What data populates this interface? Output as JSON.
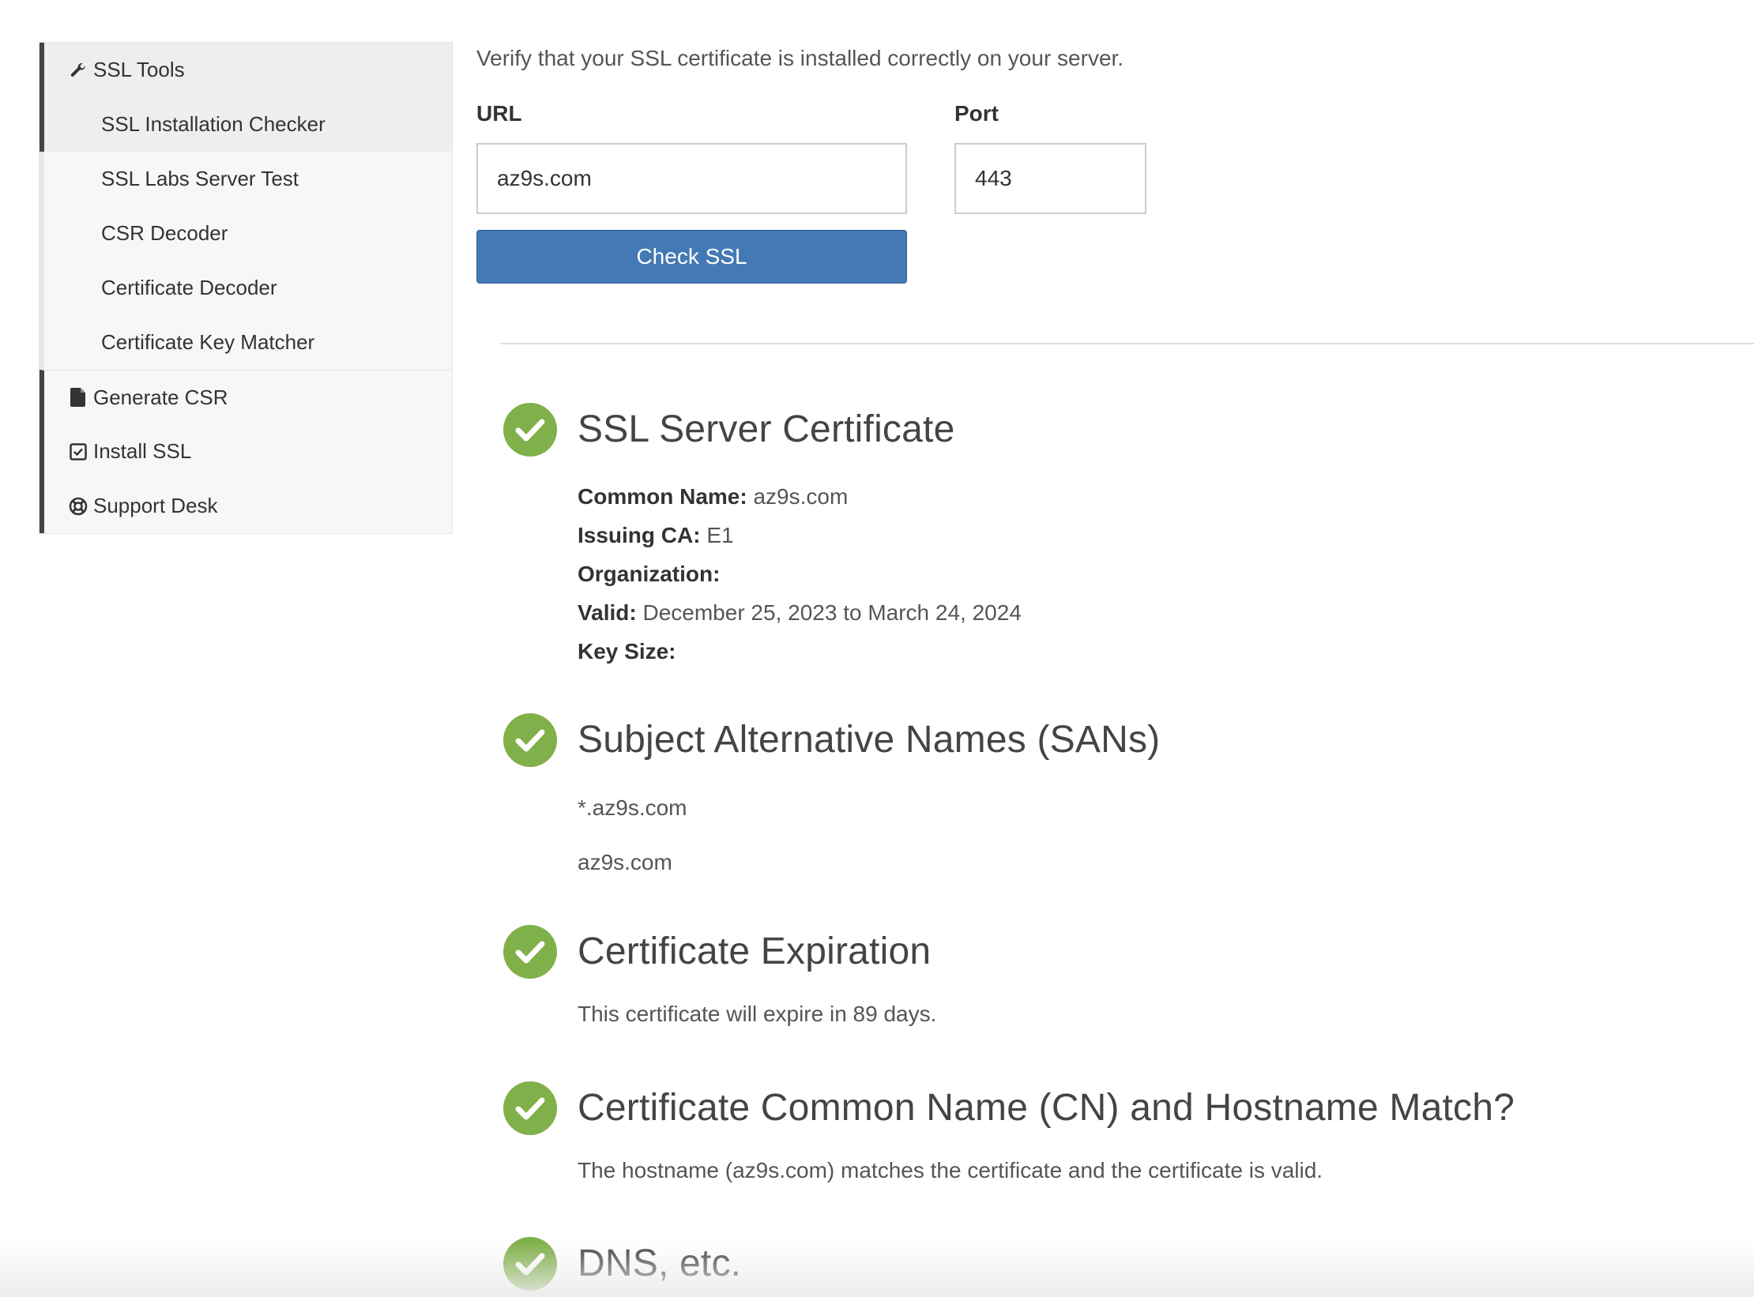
{
  "sidebar": {
    "items": [
      {
        "label": "SSL Tools",
        "icon": "wrench-icon"
      },
      {
        "label": "SSL Installation Checker"
      },
      {
        "label": "SSL Labs Server Test"
      },
      {
        "label": "CSR Decoder"
      },
      {
        "label": "Certificate Decoder"
      },
      {
        "label": "Certificate Key Matcher"
      },
      {
        "label": "Generate CSR",
        "icon": "file-icon"
      },
      {
        "label": "Install SSL",
        "icon": "checkbox-icon"
      },
      {
        "label": "Support Desk",
        "icon": "lifebuoy-icon"
      }
    ]
  },
  "form": {
    "intro": "Verify that your SSL certificate is installed correctly on your server.",
    "url_label": "URL",
    "url_value": "az9s.com",
    "port_label": "Port",
    "port_value": "443",
    "submit_label": "Check SSL"
  },
  "results": {
    "server_cert": {
      "title": "SSL Server Certificate",
      "common_name_label": "Common Name:",
      "common_name": "az9s.com",
      "issuing_ca_label": "Issuing CA:",
      "issuing_ca": "E1",
      "organization_label": "Organization:",
      "organization": "",
      "valid_label": "Valid:",
      "valid": "December 25, 2023 to March 24, 2024",
      "key_size_label": "Key Size:",
      "key_size": ""
    },
    "sans": {
      "title": "Subject Alternative Names (SANs)",
      "names": [
        "*.az9s.com",
        "az9s.com"
      ]
    },
    "expiration": {
      "title": "Certificate Expiration",
      "text": "This certificate will expire in 89 days."
    },
    "cn_match": {
      "title": "Certificate Common Name (CN) and Hostname Match?",
      "text": "The hostname (az9s.com) matches the certificate and the certificate is valid."
    },
    "dns": {
      "title": "DNS, etc."
    }
  },
  "colors": {
    "accent": "#4379b5",
    "success": "#80b04a",
    "sidebar_bg": "#f7f7f7",
    "sidebar_border": "#444444"
  }
}
